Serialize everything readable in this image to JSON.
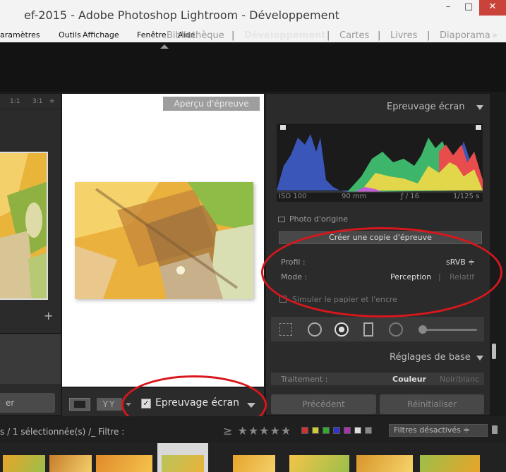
{
  "window": {
    "title": "ef-2015 - Adobe Photoshop Lightroom - Développement",
    "minimize": "–",
    "maximize": "□",
    "close": "✕"
  },
  "menu": [
    "aramètres",
    "Outils",
    "Affichage",
    "Fenêtre",
    "Aide"
  ],
  "modules": {
    "items": [
      "Bibliothèque",
      "Développement",
      "Cartes",
      "Livres",
      "Diaporama"
    ],
    "active": "Développement",
    "more": "»",
    "separator": "|"
  },
  "left_panel": {
    "zoom_1": "1:1",
    "zoom_2": "3:1",
    "zoom_arrows": "≑",
    "plus": "+",
    "button": "er"
  },
  "center": {
    "proof_label": "Aperçu d'épreuve"
  },
  "toolbar": {
    "yy": "YY",
    "check": "✓",
    "proof_label": "Epreuvage écran"
  },
  "right_panel": {
    "header": "Epreuvage écran",
    "histogram": {
      "iso": "ISO 100",
      "focal": "90 mm",
      "aperture": "ƒ / 16",
      "shutter": "1/125 s"
    },
    "photo_orig": "Photo d'origine",
    "copy_button": "Créer une copie d'épreuve",
    "profil_label": "Profil :",
    "profil_value": "sRVB ≑",
    "mode_label": "Mode :",
    "mode_perception": "Perception",
    "mode_sep": "|",
    "mode_relatif": "Relatif",
    "simulate": "Simuler le papier et l'encre",
    "section_title": "Réglages de base",
    "traitement_label": "Traitement :",
    "couleur": "Couleur",
    "noirblanc": "Noir/blanc",
    "btn_prev": "Précédent",
    "btn_reset": "Réinitialiser"
  },
  "filterbar": {
    "text": "s / 1 sélectionnée(s) /_  Filtre :",
    "stars": "≥ ★★★★★",
    "filters_off": "Filtres désactivés  ≑",
    "colors": [
      "#c33",
      "#cc3",
      "#3a3",
      "#33c",
      "#a3a",
      "#ddd",
      "#888"
    ]
  },
  "colors": {
    "accent_red": "#d8171d",
    "panel": "#2b2b2b",
    "close_btn": "#c9433b"
  }
}
